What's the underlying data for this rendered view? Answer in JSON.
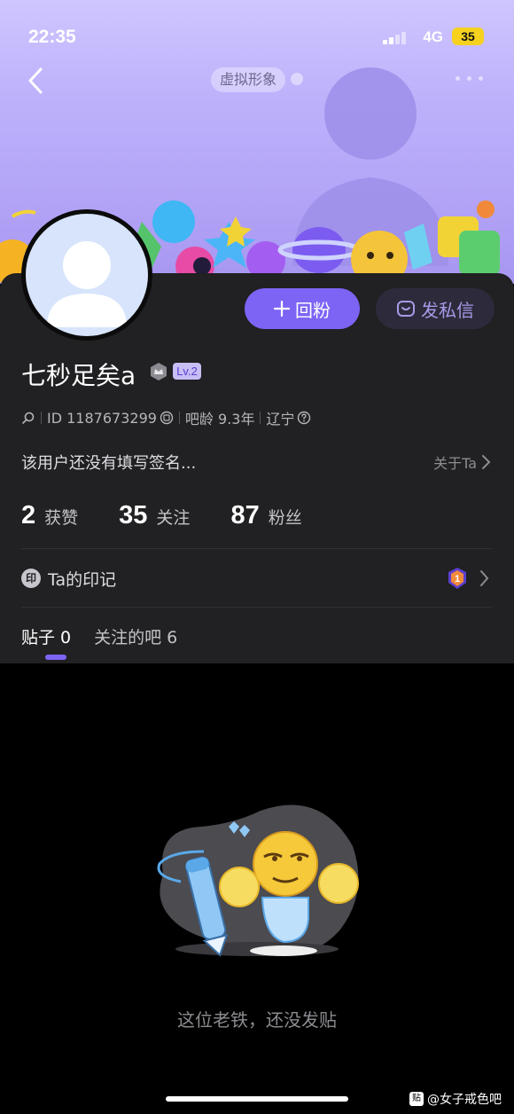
{
  "status_bar": {
    "time": "22:35",
    "network": "4G",
    "battery": "35"
  },
  "header": {
    "virtual_avatar_label": "虚拟形象"
  },
  "profile": {
    "username": "七秒足矣a",
    "level": "Lv.2",
    "id_text": "ID 1187673299",
    "age_text": "吧龄 9.3年",
    "location": "辽宁",
    "bio": "该用户还没有填写签名...",
    "about_label": "关于Ta"
  },
  "actions": {
    "follow_back_label": "回粉",
    "message_label": "发私信"
  },
  "stats": [
    {
      "value": "2",
      "label": "获赞"
    },
    {
      "value": "35",
      "label": "关注"
    },
    {
      "value": "87",
      "label": "粉丝"
    }
  ],
  "imprint": {
    "icon_text": "印",
    "label": "Ta的印记",
    "medal_number": "1"
  },
  "tabs": [
    {
      "label": "贴子 0",
      "active": true
    },
    {
      "label": "关注的吧 6",
      "active": false
    }
  ],
  "empty_state": {
    "text": "这位老铁，还没发贴"
  },
  "watermark": {
    "icon_text": "贴",
    "text": "@女子戒色吧"
  },
  "colors": {
    "accent": "#7d64f5",
    "panel": "#212022",
    "hero": "#b3a4f7"
  }
}
